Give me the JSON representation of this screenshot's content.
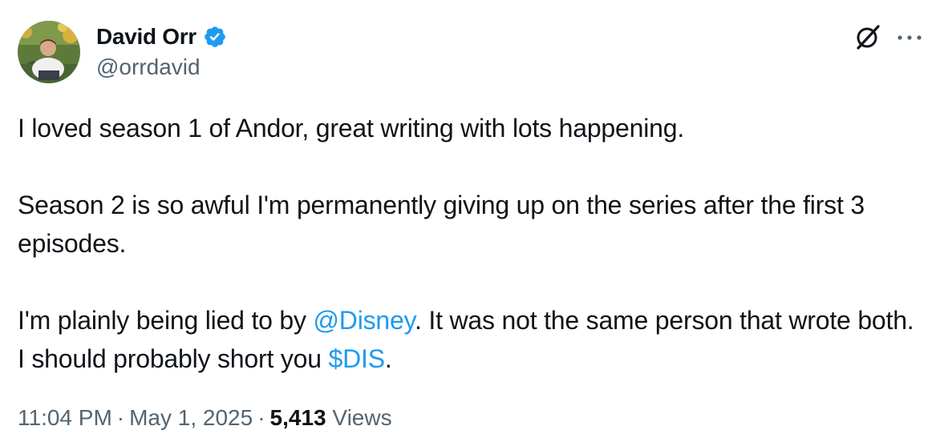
{
  "author": {
    "display_name": "David Orr",
    "handle": "@orrdavid",
    "verified_icon": "verified-badge-icon"
  },
  "actions": {
    "grok_icon": "grok-icon",
    "more_icon": "more-options-icon"
  },
  "tweet": {
    "p1": "I loved season 1 of Andor, great writing with lots happening.",
    "p2": "Season 2 is so awful I'm permanently giving up on the series after the first 3 episodes.",
    "p3_a": "I'm plainly being lied to by ",
    "p3_mention": "@Disney",
    "p3_b": ".  It was not the same person that wrote both.  I should probably short you ",
    "p3_cashtag": "$DIS",
    "p3_c": "."
  },
  "meta": {
    "time": "11:04 PM",
    "separator": "·",
    "date": "May 1, 2025",
    "views_count": "5,413",
    "views_label": "Views"
  },
  "colors": {
    "text": "#0f1419",
    "secondary": "#536471",
    "link": "#1d9bf0",
    "verified": "#1d9bf0"
  }
}
